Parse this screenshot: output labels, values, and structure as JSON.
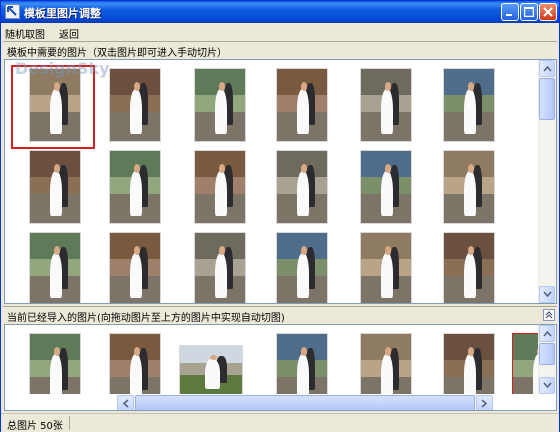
{
  "window": {
    "title": "模板里图片调整",
    "icon": "arrow-app-icon",
    "controls": [
      "minimize-icon",
      "maximize-icon",
      "close-icon"
    ]
  },
  "menu": {
    "items": [
      "随机取图",
      "返回"
    ]
  },
  "top_panel": {
    "label": "模板中需要的图片（双击图片即可进入手动切片）",
    "selected_index": 0
  },
  "bottom_panel": {
    "label": "当前已经导入的图片(向拖动图片至上方的图片中实现自动切图)"
  },
  "status": {
    "text": "总图片 50张"
  },
  "watermark": "DesignSky",
  "colors": {
    "title_bar": "#0a5fdc",
    "selection_border": "#d02020",
    "panel_border": "#7f9db9"
  }
}
